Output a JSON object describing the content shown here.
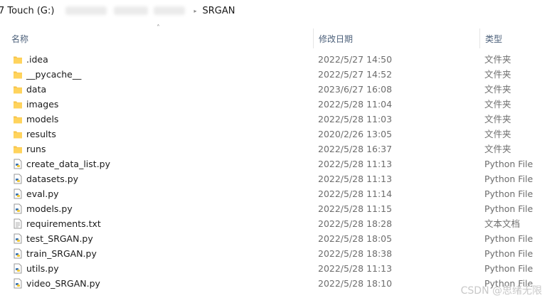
{
  "address": {
    "drive_label": "7 Touch (G:)",
    "folder_name": "SRGAN"
  },
  "columns": {
    "name": "名称",
    "date": "修改日期",
    "type": "类型"
  },
  "files": [
    {
      "name": ".idea",
      "date": "2022/5/27 14:50",
      "type": "文件夹",
      "icon": "folder-icon"
    },
    {
      "name": "__pycache__",
      "date": "2022/5/27 14:52",
      "type": "文件夹",
      "icon": "folder-icon"
    },
    {
      "name": "data",
      "date": "2023/6/27 16:08",
      "type": "文件夹",
      "icon": "folder-icon"
    },
    {
      "name": "images",
      "date": "2022/5/28 11:04",
      "type": "文件夹",
      "icon": "folder-icon"
    },
    {
      "name": "models",
      "date": "2022/5/28 11:03",
      "type": "文件夹",
      "icon": "folder-icon"
    },
    {
      "name": "results",
      "date": "2020/2/26 13:05",
      "type": "文件夹",
      "icon": "folder-icon"
    },
    {
      "name": "runs",
      "date": "2022/5/28 16:37",
      "type": "文件夹",
      "icon": "folder-icon"
    },
    {
      "name": "create_data_list.py",
      "date": "2022/5/28 11:13",
      "type": "Python File",
      "icon": "python-file-icon"
    },
    {
      "name": "datasets.py",
      "date": "2022/5/28 11:13",
      "type": "Python File",
      "icon": "python-file-icon"
    },
    {
      "name": "eval.py",
      "date": "2022/5/28 11:14",
      "type": "Python File",
      "icon": "python-file-icon"
    },
    {
      "name": "models.py",
      "date": "2022/5/28 11:15",
      "type": "Python File",
      "icon": "python-file-icon"
    },
    {
      "name": "requirements.txt",
      "date": "2022/5/28 18:28",
      "type": "文本文档",
      "icon": "text-file-icon"
    },
    {
      "name": "test_SRGAN.py",
      "date": "2022/5/28 18:05",
      "type": "Python File",
      "icon": "python-file-icon"
    },
    {
      "name": "train_SRGAN.py",
      "date": "2022/5/28 18:38",
      "type": "Python File",
      "icon": "python-file-icon"
    },
    {
      "name": "utils.py",
      "date": "2022/5/28 11:13",
      "type": "Python File",
      "icon": "python-file-icon"
    },
    {
      "name": "video_SRGAN.py",
      "date": "2022/5/28 18:10",
      "type": "Python File",
      "icon": "python-file-icon"
    }
  ],
  "watermark": "CSDN @思绪无限"
}
